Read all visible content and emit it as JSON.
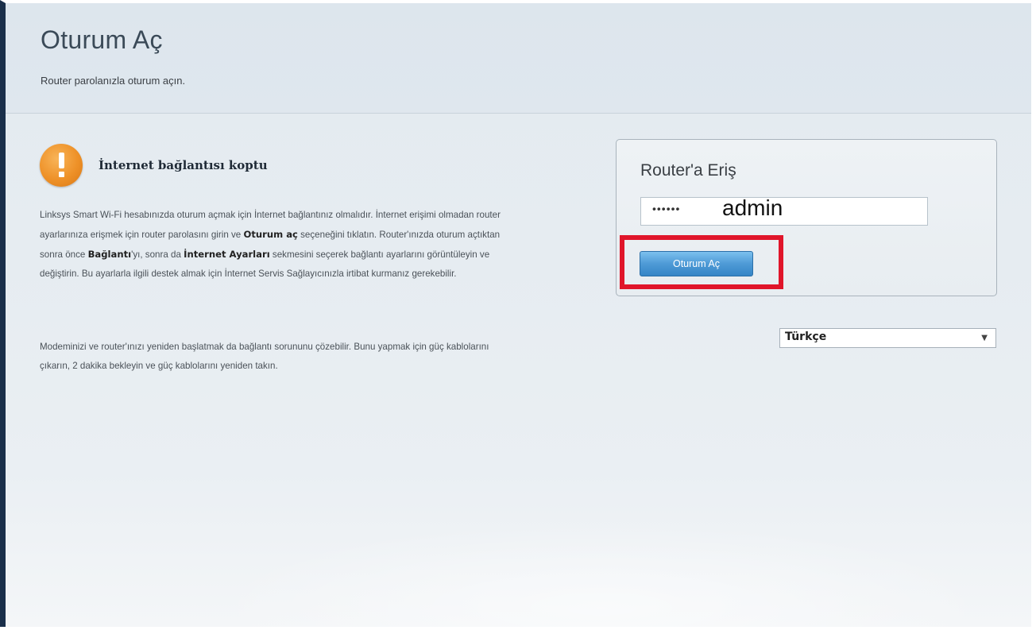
{
  "header": {
    "title": "Oturum Aç",
    "subtitle": "Router parolanızla oturum açın."
  },
  "warning": {
    "icon": "exclamation-icon",
    "title": "İnternet bağlantısı koptu",
    "para1": {
      "t1": "Linksys Smart Wi-Fi hesabınızda oturum açmak için İnternet bağlantınız olmalıdır. İnternet erişimi olmadan router ayarlarınıza erişmek için router parolasını girin ve ",
      "b1": "Oturum aç",
      "t2": " seçeneğini tıklatın. Router'ınızda oturum açtıktan sonra önce ",
      "b2": "Bağlantı",
      "t3": "'yı, sonra da ",
      "b3": "İnternet Ayarları",
      "t4": " sekmesini seçerek bağlantı ayarlarını görüntüleyin ve değiştirin. Bu ayarlarla ilgili destek almak için İnternet Servis Sağlayıcınızla irtibat kurmanız gerekebilir."
    },
    "para2": "Modeminizi ve router'ınızı yeniden başlatmak da bağlantı sorununu çözebilir. Bunu yapmak için güç kablolarını çıkarın, 2 dakika bekleyin ve güç kablolarını yeniden takın."
  },
  "login": {
    "title": "Router'a Eriş",
    "password_masked": "••••••",
    "password_annotation": "admin",
    "button_label": "Oturum Aç"
  },
  "language": {
    "selected": "Türkçe",
    "arrow": "▼"
  },
  "colors": {
    "highlight": "#e0152a",
    "button": "#4e9ad6",
    "warning": "#ee9128"
  }
}
